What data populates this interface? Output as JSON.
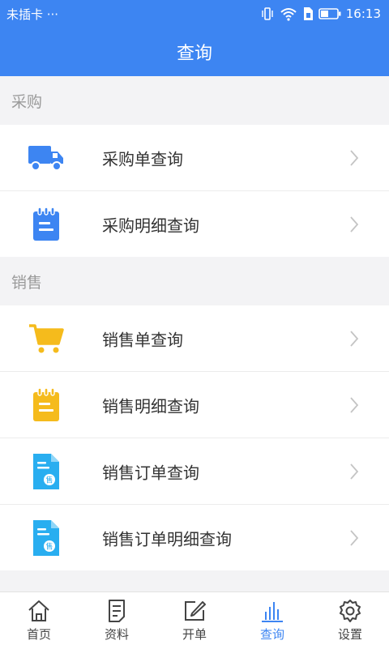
{
  "status_bar": {
    "carrier": "未插卡 ···",
    "time": "16:13",
    "icons": [
      "vibrate-icon",
      "wifi-icon",
      "sim-icon",
      "battery-icon"
    ]
  },
  "header": {
    "title": "查询"
  },
  "sections": [
    {
      "title": "采购",
      "items": [
        {
          "label": "采购单查询",
          "icon": "truck-icon",
          "icon_color": "#3d85f2"
        },
        {
          "label": "采购明细查询",
          "icon": "notepad-icon",
          "icon_color": "#3d85f2"
        }
      ]
    },
    {
      "title": "销售",
      "items": [
        {
          "label": "销售单查询",
          "icon": "cart-icon",
          "icon_color": "#f5bb1c"
        },
        {
          "label": "销售明细查询",
          "icon": "notepad-icon",
          "icon_color": "#f5bb1c"
        },
        {
          "label": "销售订单查询",
          "icon": "sales-document-icon",
          "icon_color": "#29aef0"
        },
        {
          "label": "销售订单明细查询",
          "icon": "sales-document-icon",
          "icon_color": "#29aef0"
        }
      ]
    }
  ],
  "bottom_nav": {
    "items": [
      {
        "label": "首页",
        "icon": "home-icon",
        "active": false
      },
      {
        "label": "资料",
        "icon": "document-icon",
        "active": false
      },
      {
        "label": "开单",
        "icon": "edit-icon",
        "active": false
      },
      {
        "label": "查询",
        "icon": "chart-icon",
        "active": true
      },
      {
        "label": "设置",
        "icon": "gear-icon",
        "active": false
      }
    ],
    "active_color": "#3d85f2"
  },
  "colors": {
    "primary": "#3d85f2",
    "background": "#f3f3f5",
    "section_text": "#9a9a9a",
    "item_text": "#333333"
  }
}
